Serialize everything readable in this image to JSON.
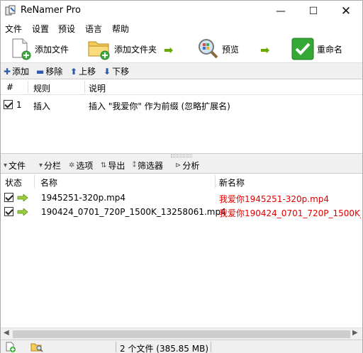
{
  "window": {
    "title": "ReNamer Pro",
    "minimize": "—",
    "maximize": "☐",
    "close": "✕"
  },
  "menu": [
    "文件",
    "设置",
    "预设",
    "语言",
    "帮助"
  ],
  "toolbar": {
    "add_files": "添加文件",
    "add_folder": "添加文件夹",
    "preview": "预览",
    "rename": "重命名"
  },
  "rules_toolbar": {
    "add": "添加",
    "remove": "移除",
    "up": "上移",
    "down": "下移"
  },
  "rules": {
    "columns": [
      "#",
      "规则",
      "说明"
    ],
    "rows": [
      {
        "checked": true,
        "index": "1",
        "rule": "插入",
        "description": "插入 \"我爱你\" 作为前缀 (忽略扩展名)"
      }
    ]
  },
  "files_toolbar": [
    "文件",
    "分栏",
    "选项",
    "导出",
    "筛选器",
    "分析"
  ],
  "files": {
    "columns": [
      "状态",
      "名称",
      "新名称"
    ],
    "rows": [
      {
        "checked": true,
        "name": "1945251-320p.mp4",
        "new_name": "我爱你1945251-320p.mp4"
      },
      {
        "checked": true,
        "name": "190424_0701_720P_1500K_13258061.mp4",
        "new_name": "我爱你190424_0701_720P_1500K_1"
      }
    ]
  },
  "status": {
    "text": "2 个文件 (385.85 MB)"
  },
  "colors": {
    "new_name": "#e00000",
    "accent_green": "#2fa82f"
  }
}
